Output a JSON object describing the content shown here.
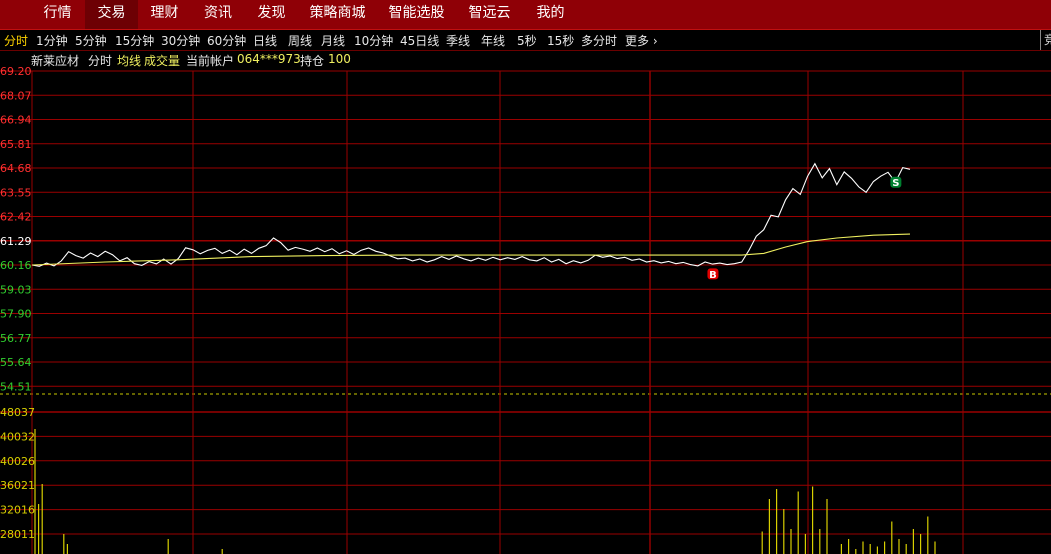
{
  "nav": {
    "tabs": [
      {
        "label": "行情",
        "active": false
      },
      {
        "label": "交易",
        "active": true
      },
      {
        "label": "理财",
        "active": false
      },
      {
        "label": "资讯",
        "active": false
      },
      {
        "label": "发现",
        "active": false
      },
      {
        "label": "策略商城",
        "active": false
      },
      {
        "label": "智能选股",
        "active": false
      },
      {
        "label": "智远云",
        "active": false
      },
      {
        "label": "我的",
        "active": false
      }
    ]
  },
  "periods": {
    "items": [
      "分时",
      "1分钟",
      "5分钟",
      "15分钟",
      "30分钟",
      "60分钟",
      "日线",
      "周线",
      "月线",
      "10分钟",
      "45日线",
      "季线",
      "年线",
      "5秒",
      "15秒",
      "多分时"
    ],
    "active_index": 0,
    "more_label": "更多",
    "more_icon": "chevron-right-icon",
    "edge_text": "竞"
  },
  "info": {
    "stock_name": "新莱应材",
    "mode": "分时",
    "avg_line": "均线",
    "volume_label": "成交量",
    "account_label": "当前帐户",
    "account_no": "064***973",
    "position_label": "持仓",
    "position_value": "100"
  },
  "colors": {
    "price_line": "#ffffff",
    "avg_line": "#f0f060",
    "grid": "#9a0000",
    "upper_label": "#ff3030",
    "lower_label": "#30d030",
    "mid_label": "#ffffff",
    "volume_bar": "#d8d000",
    "buy_marker": "#e00000",
    "sell_marker": "#008030"
  },
  "chart_data": {
    "type": "line",
    "y_ticks_price": [
      "69.20",
      "68.07",
      "66.94",
      "65.81",
      "64.68",
      "63.55",
      "62.42",
      "61.29",
      "60.16",
      "59.03",
      "57.90",
      "56.77",
      "55.64",
      "54.51"
    ],
    "ylim": [
      54.51,
      69.2
    ],
    "prev_close": 61.29,
    "x_range": [
      0,
      240
    ],
    "series": [
      {
        "name": "分时",
        "points": [
          [
            0,
            60.16
          ],
          [
            2,
            60.1
          ],
          [
            4,
            60.25
          ],
          [
            6,
            60.12
          ],
          [
            8,
            60.35
          ],
          [
            10,
            60.78
          ],
          [
            12,
            60.6
          ],
          [
            14,
            60.48
          ],
          [
            16,
            60.72
          ],
          [
            18,
            60.55
          ],
          [
            20,
            60.8
          ],
          [
            22,
            60.64
          ],
          [
            24,
            60.35
          ],
          [
            26,
            60.5
          ],
          [
            28,
            60.22
          ],
          [
            30,
            60.14
          ],
          [
            32,
            60.32
          ],
          [
            34,
            60.21
          ],
          [
            36,
            60.44
          ],
          [
            38,
            60.2
          ],
          [
            40,
            60.46
          ],
          [
            42,
            60.96
          ],
          [
            44,
            60.87
          ],
          [
            46,
            60.68
          ],
          [
            48,
            60.84
          ],
          [
            50,
            60.94
          ],
          [
            52,
            60.7
          ],
          [
            54,
            60.85
          ],
          [
            56,
            60.64
          ],
          [
            58,
            60.9
          ],
          [
            60,
            60.7
          ],
          [
            62,
            60.94
          ],
          [
            64,
            61.06
          ],
          [
            66,
            61.42
          ],
          [
            68,
            61.2
          ],
          [
            70,
            60.85
          ],
          [
            72,
            60.98
          ],
          [
            74,
            60.9
          ],
          [
            76,
            60.8
          ],
          [
            78,
            60.95
          ],
          [
            80,
            60.78
          ],
          [
            82,
            60.92
          ],
          [
            84,
            60.68
          ],
          [
            86,
            60.82
          ],
          [
            88,
            60.65
          ],
          [
            90,
            60.85
          ],
          [
            92,
            60.95
          ],
          [
            94,
            60.8
          ],
          [
            96,
            60.72
          ],
          [
            98,
            60.58
          ],
          [
            100,
            60.45
          ],
          [
            102,
            60.48
          ],
          [
            104,
            60.35
          ],
          [
            106,
            60.44
          ],
          [
            108,
            60.3
          ],
          [
            110,
            60.4
          ],
          [
            112,
            60.55
          ],
          [
            114,
            60.42
          ],
          [
            116,
            60.58
          ],
          [
            118,
            60.45
          ],
          [
            120,
            60.35
          ],
          [
            122,
            60.48
          ],
          [
            124,
            60.38
          ],
          [
            126,
            60.52
          ],
          [
            128,
            60.4
          ],
          [
            130,
            60.5
          ],
          [
            132,
            60.42
          ],
          [
            134,
            60.55
          ],
          [
            136,
            60.4
          ],
          [
            138,
            60.35
          ],
          [
            140,
            60.5
          ],
          [
            142,
            60.3
          ],
          [
            144,
            60.42
          ],
          [
            146,
            60.22
          ],
          [
            148,
            60.36
          ],
          [
            150,
            60.26
          ],
          [
            152,
            60.38
          ],
          [
            154,
            60.62
          ],
          [
            156,
            60.52
          ],
          [
            158,
            60.58
          ],
          [
            160,
            60.46
          ],
          [
            162,
            60.52
          ],
          [
            164,
            60.38
          ],
          [
            166,
            60.44
          ],
          [
            168,
            60.3
          ],
          [
            170,
            60.36
          ],
          [
            172,
            60.26
          ],
          [
            174,
            60.33
          ],
          [
            176,
            60.22
          ],
          [
            178,
            60.28
          ],
          [
            180,
            60.18
          ],
          [
            182,
            60.12
          ],
          [
            184,
            60.3
          ],
          [
            186,
            60.2
          ],
          [
            188,
            60.25
          ],
          [
            190,
            60.18
          ],
          [
            192,
            60.22
          ],
          [
            194,
            60.3
          ],
          [
            196,
            60.85
          ],
          [
            198,
            61.5
          ],
          [
            200,
            61.8
          ],
          [
            202,
            62.48
          ],
          [
            204,
            62.4
          ],
          [
            206,
            63.2
          ],
          [
            208,
            63.72
          ],
          [
            210,
            63.45
          ],
          [
            212,
            64.3
          ],
          [
            214,
            64.88
          ],
          [
            216,
            64.22
          ],
          [
            218,
            64.65
          ],
          [
            220,
            63.9
          ],
          [
            222,
            64.5
          ],
          [
            224,
            64.2
          ],
          [
            226,
            63.8
          ],
          [
            228,
            63.55
          ],
          [
            230,
            64.05
          ],
          [
            232,
            64.3
          ],
          [
            234,
            64.48
          ],
          [
            236,
            64.02
          ],
          [
            238,
            64.7
          ],
          [
            240,
            64.62
          ]
        ]
      },
      {
        "name": "均线",
        "points": [
          [
            0,
            60.16
          ],
          [
            20,
            60.3
          ],
          [
            40,
            60.4
          ],
          [
            60,
            60.55
          ],
          [
            80,
            60.6
          ],
          [
            100,
            60.62
          ],
          [
            120,
            60.62
          ],
          [
            140,
            60.62
          ],
          [
            160,
            60.62
          ],
          [
            180,
            60.62
          ],
          [
            194,
            60.62
          ],
          [
            200,
            60.7
          ],
          [
            206,
            61.0
          ],
          [
            212,
            61.25
          ],
          [
            220,
            61.42
          ],
          [
            230,
            61.55
          ],
          [
            240,
            61.6
          ]
        ]
      }
    ],
    "markers": [
      {
        "label": "B",
        "x": 186,
        "y": 60.05
      },
      {
        "label": "S",
        "x": 236,
        "y": 64.32
      }
    ],
    "volume": {
      "y_ticks": [
        "48037",
        "40032",
        "40026",
        "36021",
        "32016",
        "28011"
      ],
      "bars": [
        [
          0,
          50
        ],
        [
          1,
          20
        ],
        [
          2,
          28
        ],
        [
          8,
          8
        ],
        [
          9,
          4
        ],
        [
          37,
          6
        ],
        [
          52,
          2
        ],
        [
          202,
          9
        ],
        [
          204,
          22
        ],
        [
          206,
          26
        ],
        [
          208,
          18
        ],
        [
          210,
          10
        ],
        [
          212,
          25
        ],
        [
          214,
          8
        ],
        [
          216,
          27
        ],
        [
          218,
          10
        ],
        [
          220,
          22
        ],
        [
          224,
          4
        ],
        [
          226,
          6
        ],
        [
          228,
          2
        ],
        [
          230,
          5
        ],
        [
          232,
          4
        ],
        [
          234,
          3
        ],
        [
          236,
          5
        ],
        [
          238,
          13
        ],
        [
          240,
          6
        ],
        [
          242,
          4
        ],
        [
          244,
          10
        ],
        [
          246,
          8
        ],
        [
          248,
          15
        ],
        [
          250,
          5
        ]
      ]
    }
  }
}
